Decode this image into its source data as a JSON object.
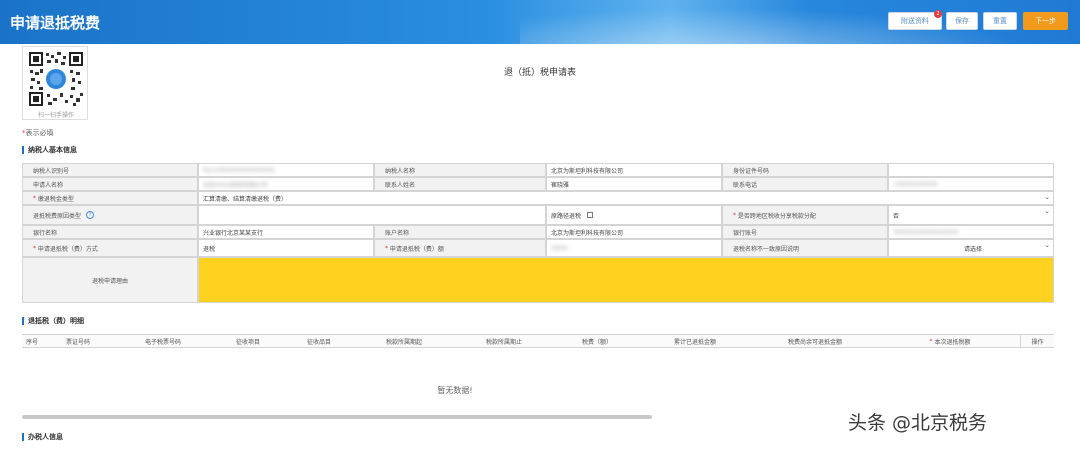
{
  "header": {
    "title": "申请退抵税费",
    "buttons": {
      "attach": "附送资料",
      "attach_badge": "2",
      "save": "保存",
      "reset": "重置",
      "next": "下一步"
    }
  },
  "qr": {
    "caption": "扫一扫手操作"
  },
  "form_title": "退（抵）税申请表",
  "required_note": {
    "star": "*",
    "text": "表示必填"
  },
  "sections": {
    "basic": "纳税人基本信息",
    "detail": "退抵税（费）明细",
    "handler": "办税人信息"
  },
  "basic_info": {
    "taxpayer_id_label": "纳税人识别号",
    "taxpayer_id_value": "91110000XXXXXXXXXX",
    "taxpayer_name_label": "纳税人名称",
    "taxpayer_name_value": "北京为斯坦利科技有限公司",
    "id_no_label": "身份证件号码",
    "applicant_label": "申请人名称",
    "applicant_value": "北京XXXX科技有限公司",
    "contact_label": "联系人姓名",
    "contact_value": "崔晓雅",
    "phone_label": "联系电话",
    "phone_value": "1XXXXXXXXXX",
    "type_label": "缴退税金类型",
    "type_value": "汇算清缴、结算清缴退税（费）",
    "reason_type_label": "退抵税费原因类型",
    "transfer_label": "原路径退税",
    "share_label": "是否跨地区税收分享税款分配",
    "share_value": "否",
    "bank_label": "银行名称",
    "bank_value": "兴业银行北京某某支行",
    "account_name_label": "账户名称",
    "account_name_value": "北京为斯坦利科技有限公司",
    "account_no_label": "银行账号",
    "account_no_value": "3XXXXXXXXXXXXXXX",
    "method_label": "申请退抵税（费）方式",
    "method_value": "退税",
    "amount_label": "申请退抵税（费）额",
    "amount_value": "XXXX",
    "name_mismatch_label": "退税名称不一致原因说明",
    "name_mismatch_value": "请选择",
    "reason_label": "退税申请理由"
  },
  "detail_table": {
    "columns": [
      "序号",
      "票证号码",
      "电子税票号码",
      "征收项目",
      "征收品目",
      "税款所属期起",
      "税款所属期止",
      "税费（额）",
      "累计已退抵金额",
      "税费尚余可退抵金额",
      "本次退抵税额",
      "操作"
    ],
    "required_col_star": "*",
    "empty_text": "暂无数据!"
  },
  "watermark": "头条 @北京税务",
  "colors": {
    "primary": "#1a73c8",
    "next_button": "#f29a1c",
    "highlight": "#ffd21f",
    "required": "#e23c3c"
  }
}
